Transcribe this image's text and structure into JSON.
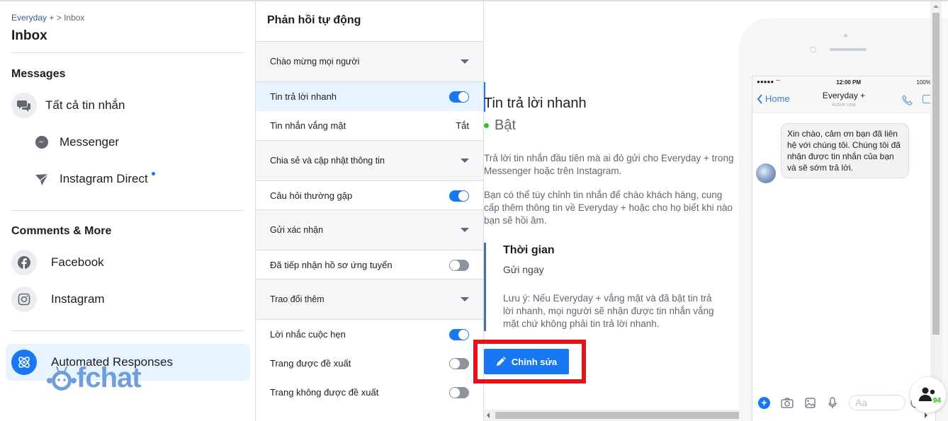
{
  "sidebar": {
    "breadcrumb": {
      "parent": "Everyday +",
      "separator": " > ",
      "current": "Inbox"
    },
    "title": "Inbox",
    "messages_section": "Messages",
    "messages_items": [
      {
        "label": "Tất cả tin nhắn",
        "icon": "chat-bubbles-icon"
      },
      {
        "label": "Messenger",
        "icon": "messenger-icon"
      },
      {
        "label": "Instagram Direct",
        "icon": "instagram-direct-icon",
        "has_unread_dot": true
      }
    ],
    "comments_section": "Comments & More",
    "comments_items": [
      {
        "label": "Facebook",
        "icon": "facebook-icon"
      },
      {
        "label": "Instagram",
        "icon": "instagram-icon"
      }
    ],
    "active_item": {
      "label": "Automated Responses",
      "icon": "atom-icon"
    },
    "watermark": "fchat"
  },
  "middle": {
    "title": "Phản hồi tự động",
    "groups": [
      {
        "label": "Chào mừng mọi người",
        "items": [
          {
            "label": "Tin trả lời nhanh",
            "toggle": "on",
            "selected": true
          },
          {
            "label": "Tin nhắn vắng mặt",
            "value": "Tắt"
          }
        ]
      },
      {
        "label": "Chia sẻ và cập nhật thông tin",
        "items": [
          {
            "label": "Câu hỏi thường gặp",
            "toggle": "on"
          }
        ]
      },
      {
        "label": "Gửi xác nhận",
        "items": [
          {
            "label": "Đã tiếp nhận hồ sơ ứng tuyển",
            "toggle": "off"
          }
        ]
      },
      {
        "label": "Trao đổi thêm",
        "items": [
          {
            "label": "Lời nhắc cuộc hẹn",
            "toggle": "on"
          },
          {
            "label": "Trang được đề xuất",
            "toggle": "off"
          },
          {
            "label": "Trang không được đề xuất",
            "toggle": "off"
          }
        ]
      }
    ]
  },
  "detail": {
    "title": "Tin trả lời nhanh",
    "status": "Bật",
    "status_color": "#42b72a",
    "desc1": "Trả lời tin nhắn đầu tiên mà ai đó gửi cho Everyday + trong Messenger hoặc trên Instagram.",
    "desc2": "Bạn có thể tùy chỉnh tin nhắn để chào khách hàng, cung cấp thêm thông tin về Everyday + hoặc cho họ biết khi nào bạn sẽ hồi âm.",
    "time_title": "Thời gian",
    "time_value": "Gửi ngay",
    "time_note": "Lưu ý: Nếu Everyday + vắng mặt và đã bật tin trả lời nhanh, mọi người sẽ nhận được tin nhắn vắng mặt chứ không phải tin trả lời nhanh.",
    "edit_button": "Chỉnh sửa"
  },
  "phone": {
    "signal": "●●●●● ",
    "time": "12:00 PM",
    "battery": "100%",
    "back_label": "Home",
    "chat_name": "Everyday +",
    "chat_status": "Active now",
    "message": "Xin chào, cảm ơn bạn đã liên hệ với chúng tôi. Chúng tôi đã nhận được tin nhắn của bạn và sẽ sớm trả lời.",
    "input_placeholder": "Aa"
  },
  "fab": {
    "count": "94"
  },
  "colors": {
    "accent": "#1877f2",
    "highlight": "#e3151c",
    "selected_bg": "#e7f3ff"
  }
}
